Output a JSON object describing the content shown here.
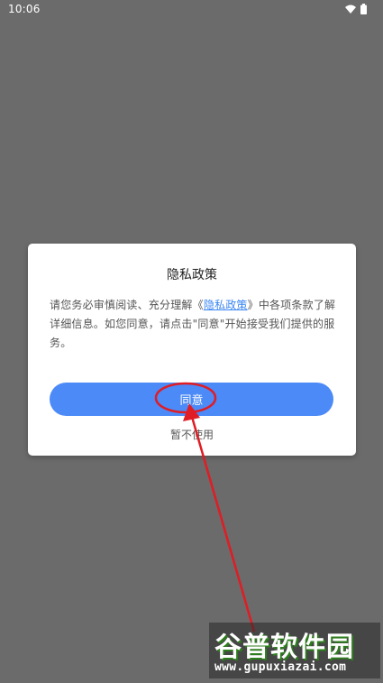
{
  "status_bar": {
    "time": "10:06",
    "icons": [
      "wifi-icon",
      "battery-icon"
    ]
  },
  "dialog": {
    "title": "隐私政策",
    "body_before_link": "请您务必审慎阅读、充分理解《",
    "link_text": "隐私政策",
    "body_after_link": "》中各项条款了解详细信息。如您同意，请点击\"同意\"开始接受我们提供的服务。",
    "agree_label": "同意",
    "decline_label": "暂不使用"
  },
  "watermark": {
    "title": "谷普软件园",
    "url": "www.gupuxiazai.com"
  },
  "colors": {
    "overlay_bg": "#6b6b6b",
    "accent": "#4b8af7",
    "link": "#3a86f5",
    "annotation": "#e01c24"
  }
}
